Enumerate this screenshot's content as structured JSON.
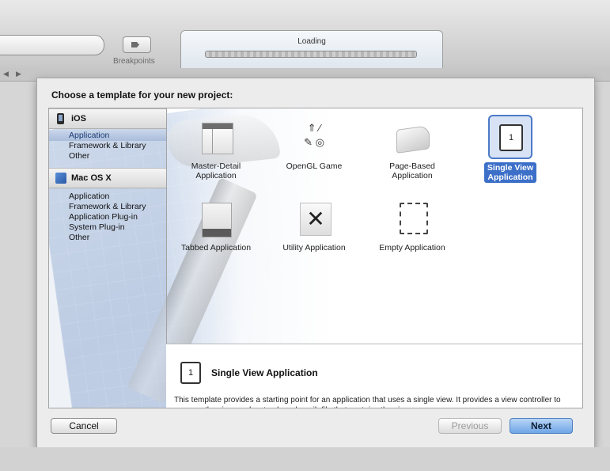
{
  "toolbar": {
    "breakpoints_label": "Breakpoints",
    "activity_title": "Loading"
  },
  "nav": {
    "back": "◀",
    "forward": "▶"
  },
  "sheet": {
    "title": "Choose a template for your new project:",
    "sidebar": {
      "sections": [
        {
          "name": "iOS",
          "items": [
            "Application",
            "Framework & Library",
            "Other"
          ],
          "selected": "Application"
        },
        {
          "name": "Mac OS X",
          "items": [
            "Application",
            "Framework & Library",
            "Application Plug-in",
            "System Plug-in",
            "Other"
          ]
        }
      ]
    },
    "templates": [
      {
        "name": "Master-Detail\nApplication",
        "icon": "master-detail-icon"
      },
      {
        "name": "OpenGL Game",
        "icon": "opengl-game-icon"
      },
      {
        "name": "Page-Based\nApplication",
        "icon": "page-based-icon"
      },
      {
        "name": "Single View\nApplication",
        "icon": "single-view-icon",
        "selected": true
      },
      {
        "name": "Tabbed Application",
        "icon": "tabbed-icon"
      },
      {
        "name": "Utility Application",
        "icon": "utility-icon"
      },
      {
        "name": "Empty Application",
        "icon": "empty-icon"
      }
    ],
    "single_view_glyph": "1",
    "opengl_glyphs": "⇑ ⁄ ✎ ◎",
    "utility_glyph": "✕",
    "description": {
      "title": "Single View Application",
      "text": "This template provides a starting point for an application that uses a single view. It provides a view controller to manage the view, and a storyboard or nib file that contains the view."
    },
    "buttons": {
      "cancel": "Cancel",
      "previous": "Previous",
      "next": "Next"
    }
  },
  "colors": {
    "selection": "#3c6fc8",
    "next_button": "#6fa6e6",
    "blueprint": "#7e9dcc"
  }
}
